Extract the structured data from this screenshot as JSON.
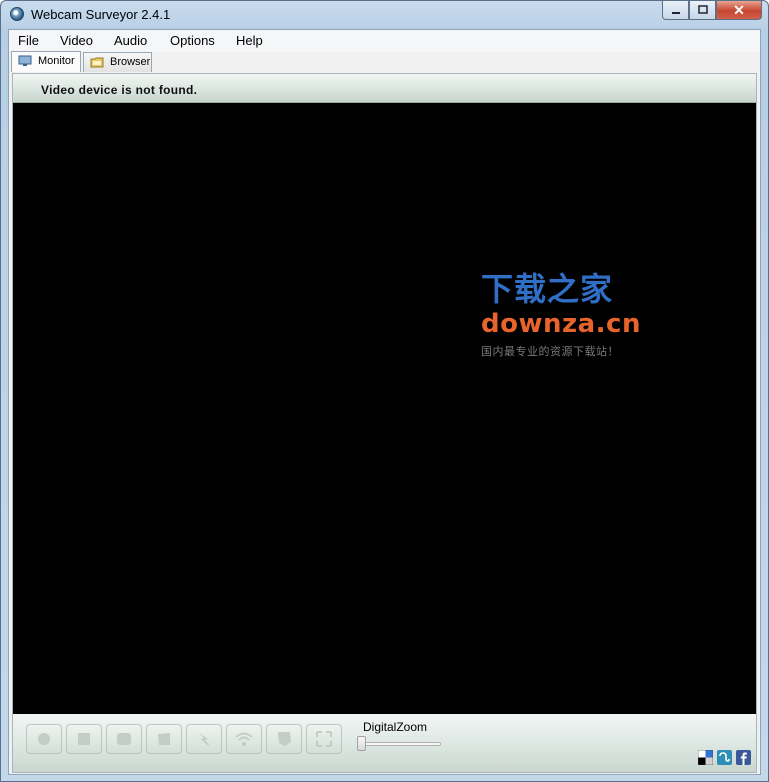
{
  "window": {
    "title": "Webcam Surveyor 2.4.1",
    "close_glyph": "✕",
    "minimize_glyph": "—",
    "maximize_glyph": "☐"
  },
  "menu": {
    "items": [
      "File",
      "Video",
      "Audio",
      "Options",
      "Help"
    ]
  },
  "tabs": [
    {
      "label": "Monitor",
      "icon": "monitor-icon",
      "active": true
    },
    {
      "label": "Browser",
      "icon": "folder-icon",
      "active": false
    }
  ],
  "status": {
    "message": "Video device is not found."
  },
  "watermark": {
    "line1": "下载之家",
    "line2": "downza.cn",
    "line3": "国内最专业的资源下载站！"
  },
  "toolbar": {
    "buttons": [
      "record-icon",
      "stop-icon",
      "capture-icon",
      "snapshot-icon",
      "motion-detect-icon",
      "broadcast-icon",
      "settings-icon",
      "fullscreen-icon"
    ],
    "zoom_label": "DigitalZoom",
    "zoom_value": 0
  },
  "social": [
    "delicious-icon",
    "stumbleupon-icon",
    "facebook-icon"
  ],
  "colors": {
    "watermark_blue": "#2f6fc5",
    "watermark_orange": "#e8642d",
    "video_bg": "#000000"
  }
}
